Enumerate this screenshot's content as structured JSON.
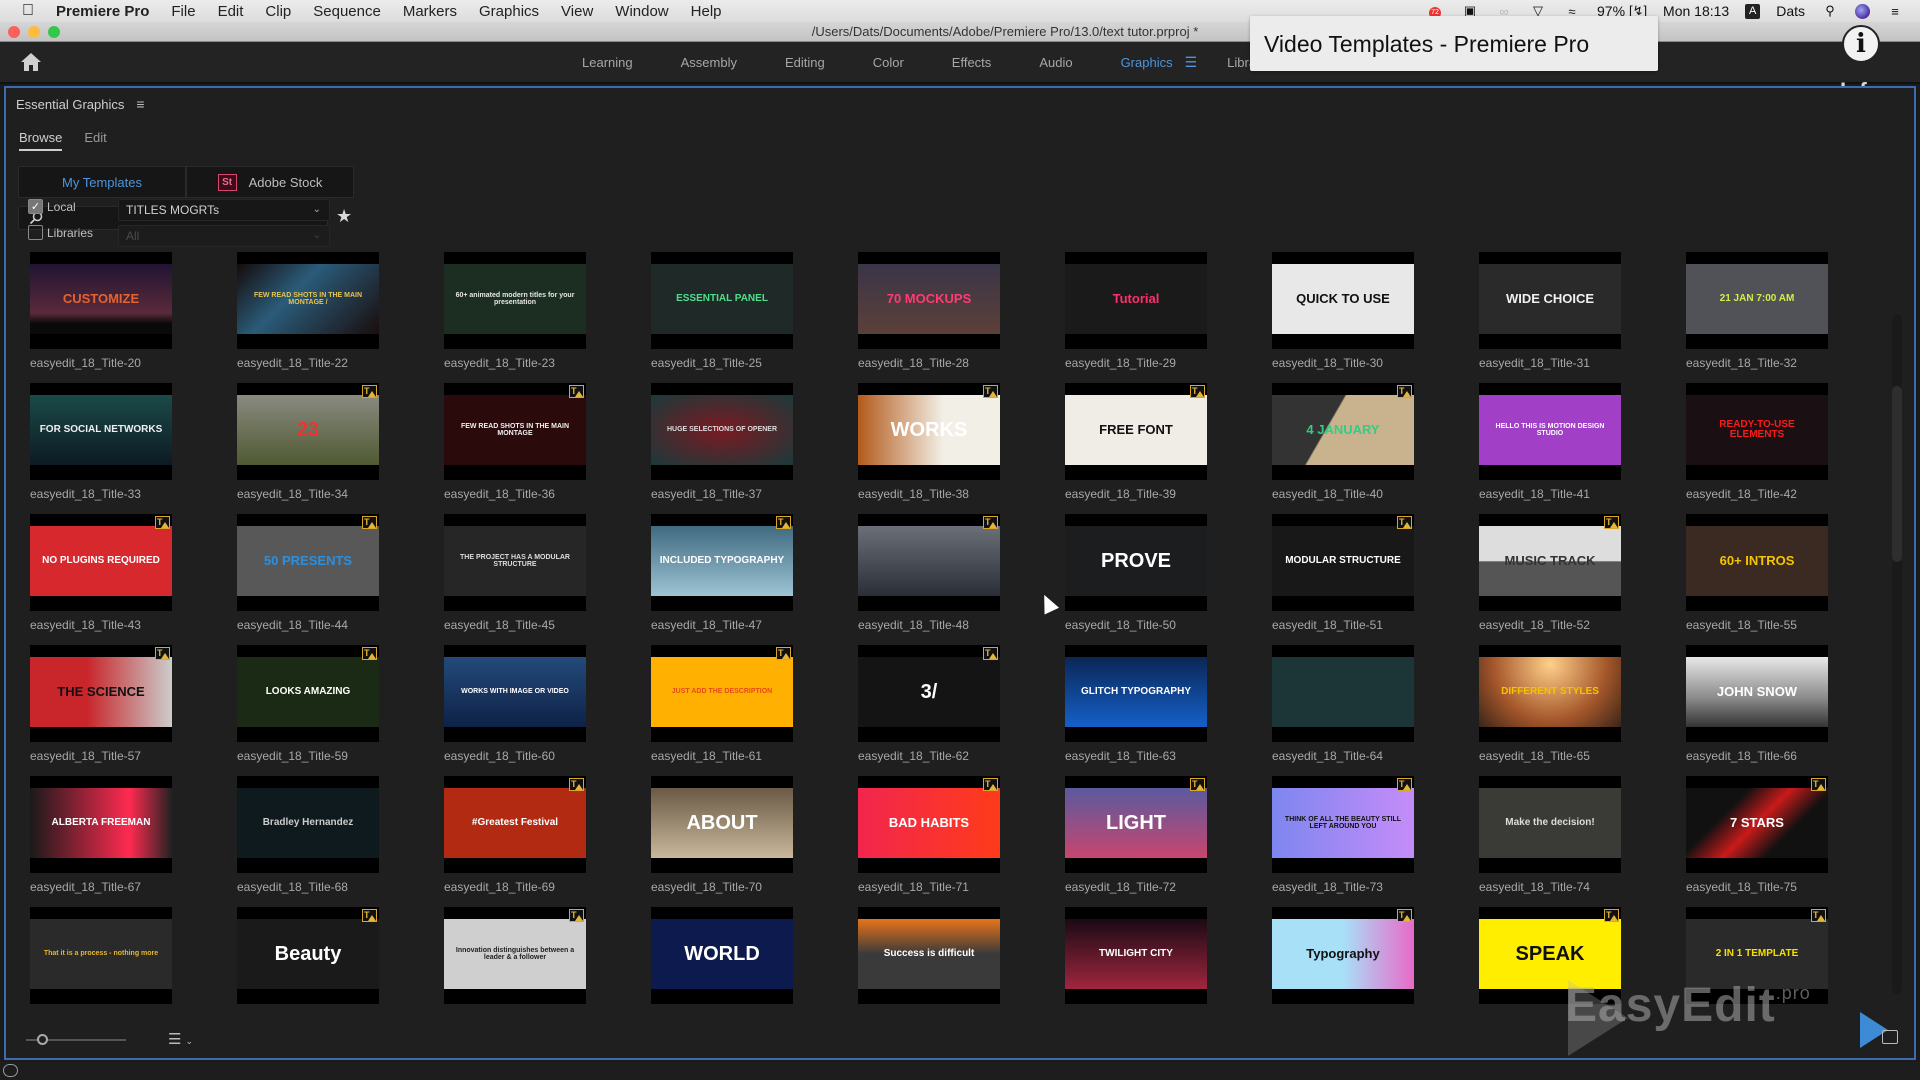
{
  "menubar": {
    "app_name": "Premiere Pro",
    "items": [
      "File",
      "Edit",
      "Clip",
      "Sequence",
      "Markers",
      "Graphics",
      "View",
      "Window",
      "Help"
    ],
    "notification_count": "72",
    "battery": "97%",
    "clock": "Mon 18:13",
    "input_source": "A",
    "user": "Dats"
  },
  "window": {
    "path": "/Users/Dats/Documents/Adobe/Premiere Pro/13.0/text tutor.prproj *"
  },
  "workspaces": {
    "tabs": [
      "Learning",
      "Assembly",
      "Editing",
      "Color",
      "Effects",
      "Audio",
      "Graphics",
      "Libraries"
    ],
    "active": "Graphics",
    "overflow": "»"
  },
  "overlay": {
    "title": "Video Templates - Premiere Pro",
    "info_symbol": "i",
    "info_label": "Info"
  },
  "panel": {
    "title": "Essential Graphics",
    "tabs": [
      "Browse",
      "Edit"
    ],
    "active_tab": "Browse",
    "sources": {
      "my_templates": "My Templates",
      "adobe_stock": "Adobe Stock",
      "stock_logo": "St"
    },
    "search": {
      "value": "",
      "placeholder": ""
    },
    "local": {
      "label": "Local",
      "checked": true,
      "selected": "TITLES MOGRTs"
    },
    "libraries": {
      "label": "Libraries",
      "checked": false,
      "selected": "All"
    }
  },
  "templates": [
    {
      "name": "easyedit_18_Title-20",
      "missing_font": false,
      "thumb_text": "CUSTOMIZE",
      "bg": "linear-gradient(#201433,#5a2a3a 70%,#0a0a0a 85%)",
      "fg": "#e5622f"
    },
    {
      "name": "easyedit_18_Title-22",
      "missing_font": false,
      "thumb_text": "FEW READ SHOTS IN THE MAIN MONTAGE /",
      "bg": "linear-gradient(135deg,#140b0b,#2a5c7a 40%,#1a0d0d)",
      "fg": "#e8c44a"
    },
    {
      "name": "easyedit_18_Title-23",
      "missing_font": false,
      "thumb_text": "60+ animated modern titles for your presentation",
      "bg": "#1c2e22",
      "fg": "#e6e6e6"
    },
    {
      "name": "easyedit_18_Title-25",
      "missing_font": false,
      "thumb_text": "ESSENTIAL PANEL",
      "bg": "#1f2a28",
      "fg": "#4de08a"
    },
    {
      "name": "easyedit_18_Title-28",
      "missing_font": false,
      "thumb_text": "70 MOCKUPS",
      "bg": "linear-gradient(#3a3548,#5c4038)",
      "fg": "#ff3b73"
    },
    {
      "name": "easyedit_18_Title-29",
      "missing_font": false,
      "thumb_text": "Tutorial",
      "bg": "#1a1a1a",
      "fg": "#ff2f6d"
    },
    {
      "name": "easyedit_18_Title-30",
      "missing_font": false,
      "thumb_text": "QUICK TO USE",
      "bg": "#e8e8e8",
      "fg": "#111"
    },
    {
      "name": "easyedit_18_Title-31",
      "missing_font": false,
      "thumb_text": "WIDE CHOICE",
      "bg": "#2a2a2a",
      "fg": "#f0f0f0"
    },
    {
      "name": "easyedit_18_Title-32",
      "missing_font": false,
      "thumb_text": "21 JAN 7:00 AM",
      "bg": "#505258",
      "fg": "#d4ec4a"
    },
    {
      "name": "easyedit_18_Title-33",
      "missing_font": false,
      "thumb_text": "FOR SOCIAL NETWORKS",
      "bg": "linear-gradient(#1b4a48,#0d1a24)",
      "fg": "#f0f0f0"
    },
    {
      "name": "easyedit_18_Title-34",
      "missing_font": true,
      "thumb_text": "23",
      "bg": "linear-gradient(#8a8a80,#4f5a32)",
      "fg": "#e33"
    },
    {
      "name": "easyedit_18_Title-36",
      "missing_font": true,
      "thumb_text": "FEW READ SHOTS IN THE MAIN MONTAGE",
      "bg": "#2a0a0a",
      "fg": "#f0f0f0"
    },
    {
      "name": "easyedit_18_Title-37",
      "missing_font": false,
      "thumb_text": "HUGE SELECTIONS OF OPENER",
      "bg": "radial-gradient(#7a1a22,#1a3a3a)",
      "fg": "#ddd"
    },
    {
      "name": "easyedit_18_Title-38",
      "missing_font": true,
      "thumb_text": "WORKS",
      "bg": "linear-gradient(90deg,#b45a1c,#f2efe6 60%)",
      "fg": "#fff"
    },
    {
      "name": "easyedit_18_Title-39",
      "missing_font": true,
      "thumb_text": "FREE FONT",
      "bg": "#f0ece6",
      "fg": "#111"
    },
    {
      "name": "easyedit_18_Title-40",
      "missing_font": true,
      "thumb_text": "4 JANUARY",
      "bg": "linear-gradient(120deg,#333 40%,#c9b28e 41%)",
      "fg": "#2ecf80"
    },
    {
      "name": "easyedit_18_Title-41",
      "missing_font": false,
      "thumb_text": "HELLO THIS IS MOTION DESIGN STUDIO",
      "bg": "#a13fc6",
      "fg": "#fff"
    },
    {
      "name": "easyedit_18_Title-42",
      "missing_font": false,
      "thumb_text": "READY-TO-USE ELEMENTS",
      "bg": "#1a1014",
      "fg": "#ff1a1a"
    },
    {
      "name": "easyedit_18_Title-43",
      "missing_font": true,
      "thumb_text": "NO PLUGINS REQUIRED",
      "bg": "#d7282e",
      "fg": "#fff"
    },
    {
      "name": "easyedit_18_Title-44",
      "missing_font": true,
      "thumb_text": "50 PRESENTS",
      "bg": "#585858",
      "fg": "#2b8fe0"
    },
    {
      "name": "easyedit_18_Title-45",
      "missing_font": false,
      "thumb_text": "THE PROJECT HAS A MODULAR STRUCTURE",
      "bg": "#262626",
      "fg": "#ddd"
    },
    {
      "name": "easyedit_18_Title-47",
      "missing_font": true,
      "thumb_text": "INCLUDED TYPOGRAPHY",
      "bg": "linear-gradient(#406a80,#9cc4d4)",
      "fg": "#fff"
    },
    {
      "name": "easyedit_18_Title-48",
      "missing_font": true,
      "thumb_text": "",
      "bg": "linear-gradient(#6b6f78,#2a2e36)",
      "fg": "#1d6fe0"
    },
    {
      "name": "easyedit_18_Title-50",
      "missing_font": false,
      "thumb_text": "PROVE",
      "bg": "#1b1d1e",
      "fg": "#fff"
    },
    {
      "name": "easyedit_18_Title-51",
      "missing_font": true,
      "thumb_text": "MODULAR STRUCTURE",
      "bg": "#181818",
      "fg": "#fff"
    },
    {
      "name": "easyedit_18_Title-52",
      "missing_font": true,
      "thumb_text": "MUSIC TRACK",
      "bg": "linear-gradient(#ddd 50%,#555 51%)",
      "fg": "#333"
    },
    {
      "name": "easyedit_18_Title-55",
      "missing_font": false,
      "thumb_text": "60+ INTROS",
      "bg": "#3a2a22",
      "fg": "#f5c400"
    },
    {
      "name": "easyedit_18_Title-57",
      "missing_font": true,
      "thumb_text": "THE SCIENCE",
      "bg": "linear-gradient(90deg,#c8262a 40%,#ccc)",
      "fg": "#111"
    },
    {
      "name": "easyedit_18_Title-59",
      "missing_font": true,
      "thumb_text": "LOOKS AMAZING",
      "bg": "#1a2a14",
      "fg": "#fff"
    },
    {
      "name": "easyedit_18_Title-60",
      "missing_font": false,
      "thumb_text": "WORKS WITH IMAGE OR VIDEO",
      "bg": "linear-gradient(#234a7a,#0e2246)",
      "fg": "#fff"
    },
    {
      "name": "easyedit_18_Title-61",
      "missing_font": true,
      "thumb_text": "JUST ADD THE DESCRIPTION",
      "bg": "#ffb000",
      "fg": "#e84a1a"
    },
    {
      "name": "easyedit_18_Title-62",
      "missing_font": true,
      "thumb_text": "3/",
      "bg": "#141414",
      "fg": "#fff"
    },
    {
      "name": "easyedit_18_Title-63",
      "missing_font": false,
      "thumb_text": "GLITCH TYPOGRAPHY",
      "bg": "linear-gradient(#0b2656,#1460c8)",
      "fg": "#fff"
    },
    {
      "name": "easyedit_18_Title-64",
      "missing_font": false,
      "thumb_text": "",
      "bg": "#1c3638",
      "fg": "#fff"
    },
    {
      "name": "easyedit_18_Title-65",
      "missing_font": false,
      "thumb_text": "DIFFERENT STYLES",
      "bg": "radial-gradient(circle at 50% 10%,#ffd08a,#a4562a 60%,#3a2418)",
      "fg": "#f5c400"
    },
    {
      "name": "easyedit_18_Title-66",
      "missing_font": false,
      "thumb_text": "JOHN SNOW",
      "bg": "linear-gradient(#e8e8e8,#888 60%,#333)",
      "fg": "#fff"
    },
    {
      "name": "easyedit_18_Title-67",
      "missing_font": false,
      "thumb_text": "ALBERTA FREEMAN",
      "bg": "linear-gradient(90deg,#1a1a1a,#ff2a50 70%,#222)",
      "fg": "#fff"
    },
    {
      "name": "easyedit_18_Title-68",
      "missing_font": false,
      "thumb_text": "Bradley Hernandez",
      "bg": "#0e1a1e",
      "fg": "#ccc"
    },
    {
      "name": "easyedit_18_Title-69",
      "missing_font": true,
      "thumb_text": "#Greatest Festival",
      "bg": "#b22a12",
      "fg": "#fff"
    },
    {
      "name": "easyedit_18_Title-70",
      "missing_font": false,
      "thumb_text": "ABOUT",
      "bg": "linear-gradient(#6a5a46,#c9b89a)",
      "fg": "#fff"
    },
    {
      "name": "easyedit_18_Title-71",
      "missing_font": true,
      "thumb_text": "BAD HABITS",
      "bg": "linear-gradient(90deg,#f2264e,#ff3b1a)",
      "fg": "#fff"
    },
    {
      "name": "easyedit_18_Title-72",
      "missing_font": true,
      "thumb_text": "LIGHT",
      "bg": "linear-gradient(#5a5a9e,#c8466e)",
      "fg": "#fff"
    },
    {
      "name": "easyedit_18_Title-73",
      "missing_font": true,
      "thumb_text": "THINK OF ALL THE BEAUTY STILL LEFT AROUND YOU",
      "bg": "linear-gradient(90deg,#7e86f0,#c58cf8)",
      "fg": "#111"
    },
    {
      "name": "easyedit_18_Title-74",
      "missing_font": false,
      "thumb_text": "Make the decision!",
      "bg": "#3a3a36",
      "fg": "#ddd"
    },
    {
      "name": "easyedit_18_Title-75",
      "missing_font": true,
      "thumb_text": "7 STARS",
      "bg": "linear-gradient(135deg,#111 30%,#c81a1a 50%,#111 70%)",
      "fg": "#fff"
    },
    {
      "name": "",
      "missing_font": false,
      "thumb_text": "That it is a process - nothing more",
      "bg": "#2a2a2a",
      "fg": "#e8b82a"
    },
    {
      "name": "",
      "missing_font": true,
      "thumb_text": "Beauty",
      "bg": "#1a1a1a",
      "fg": "#fff"
    },
    {
      "name": "",
      "missing_font": true,
      "thumb_text": "Innovation distinguishes between a leader & a follower",
      "bg": "#cfcfcf",
      "fg": "#222"
    },
    {
      "name": "",
      "missing_font": false,
      "thumb_text": "WORLD",
      "bg": "#0c1a4e",
      "fg": "#fff"
    },
    {
      "name": "",
      "missing_font": false,
      "thumb_text": "Success is difficult",
      "bg": "linear-gradient(#e8741a,#3a3a3a 50%)",
      "fg": "#fff"
    },
    {
      "name": "",
      "missing_font": false,
      "thumb_text": "TWILIGHT CITY",
      "bg": "linear-gradient(#1a0a14,#a0263e)",
      "fg": "#fff"
    },
    {
      "name": "",
      "missing_font": true,
      "thumb_text": "Typography",
      "bg": "linear-gradient(90deg,#a8e0f8 50%,#e86ac8)",
      "fg": "#111"
    },
    {
      "name": "",
      "missing_font": true,
      "thumb_text": "SPEAK",
      "bg": "#ffee00",
      "fg": "#111"
    },
    {
      "name": "",
      "missing_font": true,
      "thumb_text": "2 IN 1 TEMPLATE",
      "bg": "#2a2a2a",
      "fg": "#f5e000"
    }
  ],
  "footer": {
    "thumbnail_size": 0.15,
    "sort_icon": "sort-icon"
  },
  "watermark": {
    "text": "EasyEdit",
    "suffix": ".pro"
  }
}
